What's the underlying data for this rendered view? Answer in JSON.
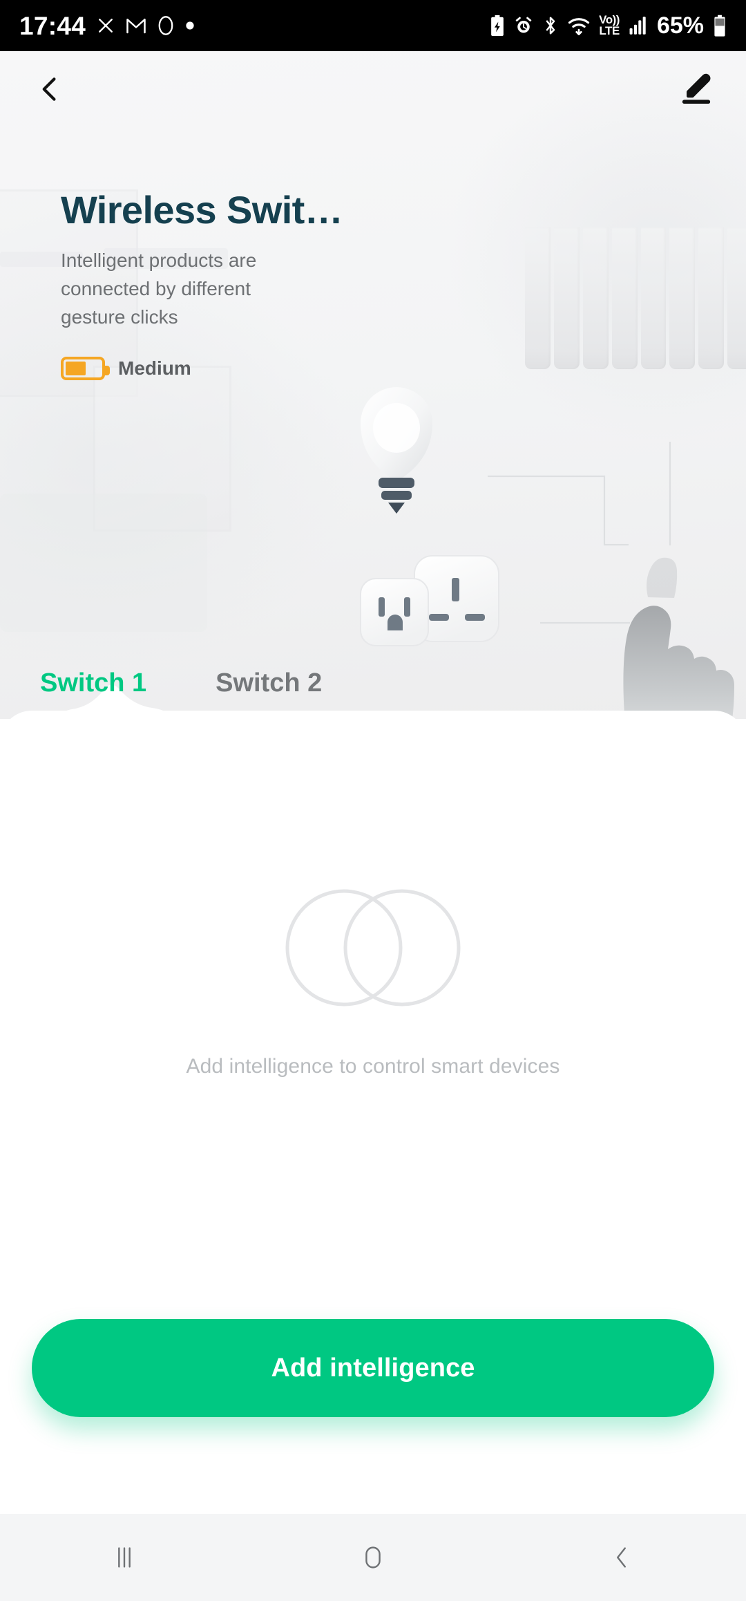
{
  "status_bar": {
    "time": "17:44",
    "battery_percent": "65%",
    "network_label_top": "Vo))",
    "network_label_bottom": "LTE",
    "left_icons": [
      "do-not-disturb-icon",
      "gmail-icon",
      "circle-app-icon",
      "dot-icon"
    ],
    "right_icons": [
      "battery-saver-icon",
      "alarm-icon",
      "bluetooth-icon",
      "wifi-icon",
      "volte-icon",
      "cellular-signal-icon",
      "battery-icon"
    ]
  },
  "nav": {
    "back_icon": "chevron-left-icon",
    "edit_icon": "pencil-edit-icon"
  },
  "hero": {
    "title": "Wireless Swit…",
    "description": "Intelligent products are connected by different gesture clicks",
    "battery_label": "Medium",
    "battery_fill_percent": 58,
    "battery_color": "#f5a623",
    "title_color": "#15404f",
    "illustration": [
      "light-bulb-icon",
      "us-power-outlet-icon",
      "uk-power-outlet-icon",
      "pointing-hand-icon",
      "window-blinds-icon"
    ]
  },
  "tabs": [
    {
      "label": "Switch 1",
      "active": true
    },
    {
      "label": "Switch 2",
      "active": false
    }
  ],
  "empty_state": {
    "icon": "two-overlapping-circles-icon",
    "message": "Add intelligence to control smart devices"
  },
  "cta": {
    "label": "Add intelligence",
    "color": "#00c882"
  },
  "system_nav": {
    "recents": "recents-icon",
    "home": "home-icon",
    "back": "back-icon"
  }
}
